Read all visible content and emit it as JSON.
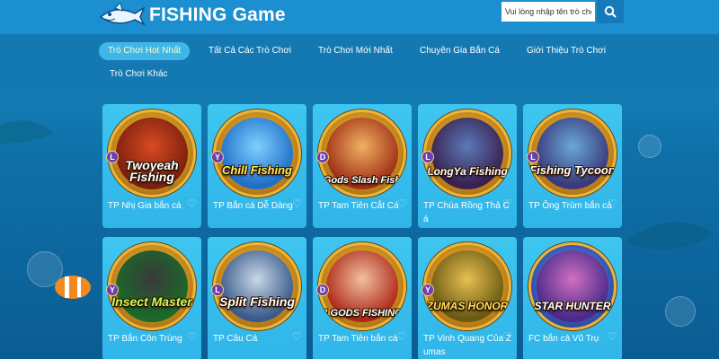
{
  "header": {
    "logo_text": "FISHING Game",
    "search_placeholder": "Vui lòng nhập tên trò chơi."
  },
  "nav": {
    "items": [
      {
        "label": "Trò Chơi Hot Nhất",
        "active": true
      },
      {
        "label": "Tất Cả Các Trò Chơi",
        "active": false
      },
      {
        "label": "Trò Chơi Mới Nhất",
        "active": false
      },
      {
        "label": "Chuyên Gia Bắn Cá",
        "active": false
      },
      {
        "label": "Giới Thiệu Trò Chơi",
        "active": false
      },
      {
        "label": "Trò Chơi Khác",
        "active": false
      }
    ]
  },
  "games": [
    {
      "name": "TP Nhị Gia bắn cá",
      "thumb_title": "Twoyeah Fishing",
      "badge": "L",
      "color": "#8a3a12"
    },
    {
      "name": "TP Bắn cá Dễ Dàng",
      "thumb_title": "Chill Fishing",
      "badge": "Y",
      "color": "#2a7fd8"
    },
    {
      "name": "TP Tam Tiên Cắt Cá",
      "thumb_title": "Gods Slash Fish",
      "badge": "D",
      "color": "#a03018"
    },
    {
      "name": "TP Chúa Rồng Thả Cá",
      "thumb_title": "LongYa Fishing",
      "badge": "L",
      "color": "#5a2a78"
    },
    {
      "name": "TP Ông Trùm bắn cá",
      "thumb_title": "Fishing Tycoon",
      "badge": "L",
      "color": "#7a2a12"
    },
    {
      "name": "TP Bắn Côn Trùng",
      "thumb_title": "Insect Master",
      "badge": "Y",
      "color": "#2a8a2a"
    },
    {
      "name": "TP Cầu Cá",
      "thumb_title": "Split Fishing",
      "badge": "L",
      "color": "#3a5a8a"
    },
    {
      "name": "TP Tam Tiên bắn cá",
      "thumb_title": "3 GODS FISHING",
      "badge": "D",
      "color": "#b02a1a"
    },
    {
      "name": "TP Vinh Quang Của Zumas",
      "thumb_title": "ZUMAS HONOR",
      "badge": "Y",
      "color": "#6a5a12"
    },
    {
      "name": "FC bắn cá Vũ Trụ",
      "thumb_title": "STAR HUNTER",
      "badge": "",
      "color": "#4a2a8a"
    }
  ],
  "colors": {
    "header_bg": "#1c8fd1",
    "nav_bg": "#1479b3",
    "active_tab": "#3fb6ea",
    "card_bg": "#3ec6f1"
  }
}
